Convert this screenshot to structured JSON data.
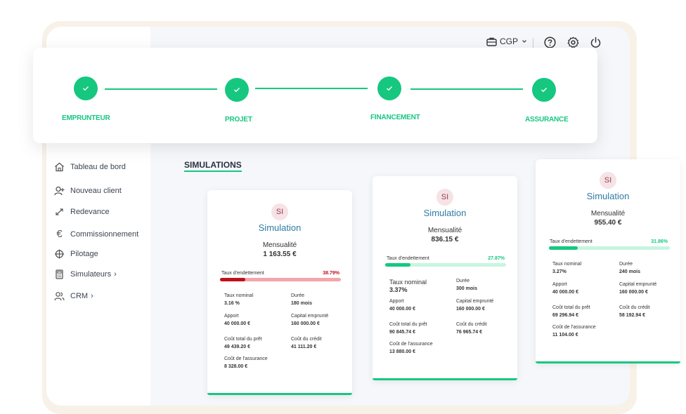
{
  "topbar": {
    "profile_label": "CGP"
  },
  "stepper": {
    "steps": [
      {
        "label": "EMPRUNTEUR"
      },
      {
        "label": "PROJET"
      },
      {
        "label": "FINANCEMENT"
      },
      {
        "label": "ASSURANCE"
      }
    ]
  },
  "sidebar": {
    "items": [
      {
        "label": "Tableau de bord",
        "icon": "home-icon"
      },
      {
        "label": "Nouveau client",
        "icon": "add-user-icon"
      },
      {
        "label": "Redevance",
        "icon": "expand-arrows-icon"
      },
      {
        "label": "Commissionnement",
        "icon": "euro-icon"
      },
      {
        "label": "Pilotage",
        "icon": "crosshair-icon"
      },
      {
        "label": "Simulateurs",
        "icon": "calculator-icon",
        "chevron": "›"
      },
      {
        "label": "CRM",
        "icon": "users-icon",
        "chevron": "›"
      }
    ]
  },
  "section": {
    "title": "SIMULATIONS"
  },
  "colors": {
    "accent": "#16c780",
    "danger": "#c0111a",
    "danger_light": "#f4a5a9",
    "accent_light": "#c7f5e1"
  },
  "cards": [
    {
      "badge": "SI",
      "title": "Simulation",
      "mensualite_label": "Mensualité",
      "mensualite_value": "1 163.55 €",
      "taux_label": "Taux d'endettement",
      "taux_value": "38.79%",
      "taux_fraction": 0.21,
      "fields": {
        "taux_nominal_label": "Taux nominal",
        "taux_nominal": "3.16 %",
        "duree_label": "Durée",
        "duree": "180 mois",
        "apport_label": "Apport",
        "apport": "40 000.00 €",
        "capital_label": "Capital emprunté",
        "capital": "160 000.00 €",
        "cout_total_label": "Coût total du prêt",
        "cout_total": "49 439.20 €",
        "cout_credit_label": "Coût du crédit",
        "cout_credit": "41 111.20 €",
        "cout_assurance_label": "Coût de l'assurance",
        "cout_assurance": "8 328.00 €"
      }
    },
    {
      "badge": "SI",
      "title": "Simulation",
      "mensualite_label": "Mensualité",
      "mensualite_value": "836.15 €",
      "taux_label": "Taux d'endettement",
      "taux_value": "27.87%",
      "taux_fraction": 0.21,
      "fields": {
        "taux_nominal_label": "Taux nominal",
        "taux_nominal": "3.37%",
        "duree_label": "Durée",
        "duree": "300 mois",
        "apport_label": "Apport",
        "apport": "40 000.00 €",
        "capital_label": "Capital emprunté",
        "capital": "160 000.00 €",
        "cout_total_label": "Coût total du prêt",
        "cout_total": "90 845.74 €",
        "cout_credit_label": "Coût du crédit",
        "cout_credit": "76 965.74 €",
        "cout_assurance_label": "Coût de l'assurance",
        "cout_assurance": "13 880.00 €"
      }
    },
    {
      "badge": "SI",
      "title": "Simulation",
      "mensualite_label": "Mensualité",
      "mensualite_value": "955.40 €",
      "taux_label": "Taux d'endettement",
      "taux_value": "31.86%",
      "taux_fraction": 0.24,
      "fields": {
        "taux_nominal_label": "Taux nominal",
        "taux_nominal": "3.27%",
        "duree_label": "Durée",
        "duree": "240 mois",
        "apport_label": "Apport",
        "apport": "40 000.00 €",
        "capital_label": "Capital emprunté",
        "capital": "160 000.00 €",
        "cout_total_label": "Coût total du prêt",
        "cout_total": "69 296.94 €",
        "cout_credit_label": "Coût du crédit",
        "cout_credit": "58 192.94 €",
        "cout_assurance_label": "Coût de l'assurance",
        "cout_assurance": "11 104.00 €"
      }
    }
  ]
}
